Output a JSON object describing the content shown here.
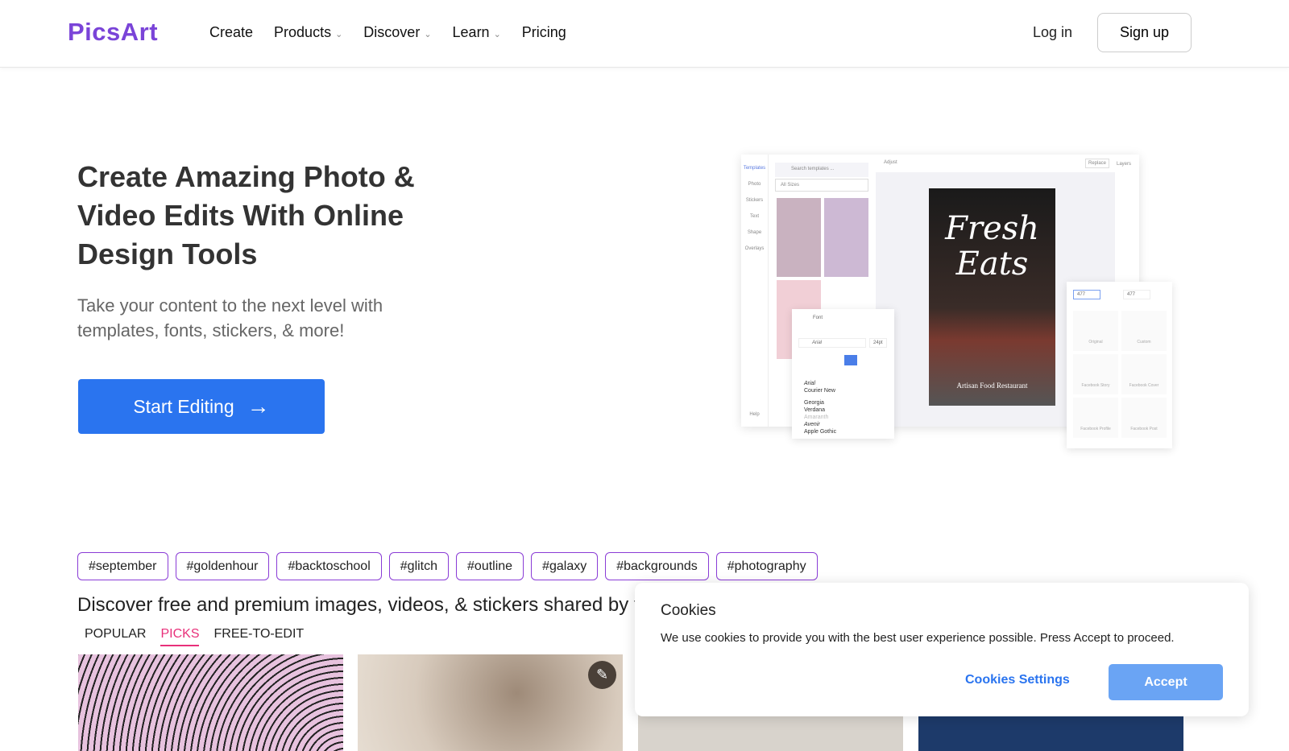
{
  "nav": {
    "logo": "PicsArt",
    "items": [
      {
        "label": "Create"
      },
      {
        "label": "Products",
        "chev": "⌄"
      },
      {
        "label": "Discover",
        "chev": "⌄"
      },
      {
        "label": "Learn",
        "chev": "⌄"
      },
      {
        "label": "Pricing"
      }
    ],
    "login": "Log in",
    "signup": "Sign up"
  },
  "hero": {
    "title": "Create Amazing Photo & Video Edits With Online Design Tools",
    "subtitle": "Take your content to the next level with templates, fonts, stickers, & more!",
    "cta": "Start Editing",
    "cta_icon": "→"
  },
  "mockup": {
    "sidebar": [
      "Templates",
      "Photo",
      "Stickers",
      "Text",
      "Shape",
      "Overlays",
      "Help"
    ],
    "search": "Search templates ...",
    "sizes": "All Sizes",
    "adjust": "Adjust",
    "replace": "Replace",
    "layers": "Layers",
    "poster_title": "Fresh Eats",
    "poster_sub": "Artisan Food Restaurant",
    "font_label": "Font",
    "font_value": "Arial",
    "font_size": "24pt",
    "fonts": [
      "Arial",
      "Courier New",
      "Georgia",
      "Verdana",
      "Amaranth",
      "Avenir",
      "Apple Gothic"
    ],
    "width": "477",
    "height": "477",
    "presets": [
      "Original",
      "Custom",
      "Facebook Story",
      "Facebook Cover",
      "Facebook Profile",
      "Facebook Post"
    ]
  },
  "tags": [
    "#september",
    "#goldenhour",
    "#backtoschool",
    "#glitch",
    "#outline",
    "#galaxy",
    "#backgrounds",
    "#photography"
  ],
  "discover": {
    "heading": "Discover free and premium images, videos, & stickers shared by t",
    "tabs": [
      "POPULAR",
      "PICKS",
      "FREE-TO-EDIT"
    ],
    "active_tab": "PICKS"
  },
  "cookies": {
    "title": "Cookies",
    "text": "We use cookies to provide you with the best user experience possible. Press Accept to proceed.",
    "settings": "Cookies Settings",
    "accept": "Accept"
  }
}
